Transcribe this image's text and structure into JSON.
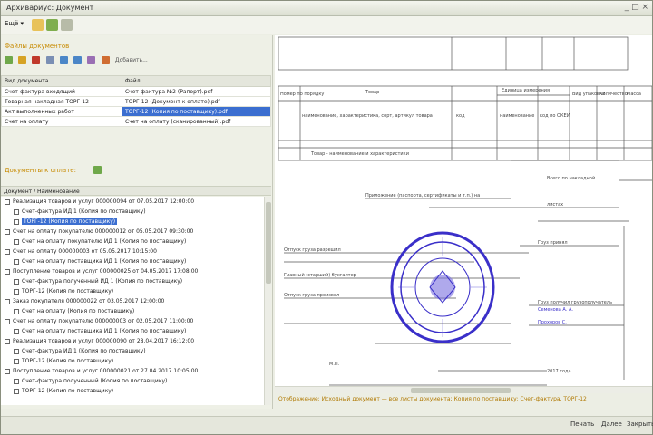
{
  "window": {
    "title": "Архивариус: Документ",
    "controls": "_ □ ×"
  },
  "menubar": {
    "more_label": "Ещё ▾"
  },
  "left": {
    "docs_section_title": "Файлы документов",
    "mini_toolbar_label": "Добавить...",
    "table": {
      "columns": [
        "Вид документа",
        "Файл"
      ],
      "rows": [
        [
          "Счет-фактура входящий",
          "Счет-фактура №2 (Рапорт).pdf"
        ],
        [
          "Товарная накладная ТОРГ-12",
          "ТОРГ-12 (Документ к оплате).pdf"
        ],
        [
          "Акт выполненных работ",
          "ТОРГ-12 (Копия по поставщику).pdf"
        ],
        [
          "Счет на оплату",
          "Счет на оплату (сканированный).pdf"
        ]
      ]
    },
    "links_section_title": "Документы к оплате:",
    "tree": {
      "header": "Документ / Наименование",
      "items": [
        {
          "level": 0,
          "label": "Реализация товаров и услуг 000000094 от 07.05.2017 12:00:00"
        },
        {
          "level": 1,
          "label": "Счет-фактура ИД 1 (Копия по поставщику)"
        },
        {
          "level": 1,
          "label": "ТОРГ-12 (Копия по поставщику)",
          "selected": true
        },
        {
          "level": 0,
          "label": "Счет на оплату покупателю 000000012 от 05.05.2017 09:30:00"
        },
        {
          "level": 1,
          "label": "Счет на оплату покупателю ИД 1 (Копия по поставщику)"
        },
        {
          "level": 0,
          "label": "Счет на оплату 000000003 от 05.05.2017 10:15:00"
        },
        {
          "level": 1,
          "label": "Счет на оплату поставщика ИД 1 (Копия по поставщику)"
        },
        {
          "level": 0,
          "label": "Поступление товаров и услуг 000000025 от 04.05.2017 17:08:00"
        },
        {
          "level": 1,
          "label": "Счет-фактура полученный ИД 1 (Копия по поставщику)"
        },
        {
          "level": 1,
          "label": "ТОРГ-12 (Копия по поставщику)"
        },
        {
          "level": 0,
          "label": "Заказ покупателя 000000022 от 03.05.2017 12:00:00"
        },
        {
          "level": 1,
          "label": "Счет на оплату (Копия по поставщику)"
        },
        {
          "level": 0,
          "label": "Счет на оплату покупателю 000000003 от 02.05.2017 11:00:00"
        },
        {
          "level": 1,
          "label": "Счет на оплату поставщика ИД 1 (Копия по поставщику)"
        },
        {
          "level": 0,
          "label": "Реализация товаров и услуг 000000090 от 28.04.2017 16:12:00"
        },
        {
          "level": 1,
          "label": "Счет-фактура ИД 1 (Копия по поставщику)"
        },
        {
          "level": 1,
          "label": "ТОРГ-12 (Копия по поставщику)"
        },
        {
          "level": 0,
          "label": "Поступление товаров и услуг 000000021 от 27.04.2017 10:05:00"
        },
        {
          "level": 1,
          "label": "Счет-фактура полученный (Копия по поставщику)"
        },
        {
          "level": 1,
          "label": "ТОРГ-12 (Копия по поставщику)"
        }
      ]
    }
  },
  "doc": {
    "header_cells": [
      "Номер по порядку",
      "Товар",
      "Единица измерения",
      "Вид упаковки",
      "Количество",
      "Масса",
      "Цена"
    ],
    "sub_cells": [
      "наименование, характеристика, сорт, артикул товара",
      "код",
      "наименование",
      "код по ОКЕИ"
    ],
    "row_label": "Товар - наименование и характеристики",
    "signatures": {
      "total": "Всего по накладной",
      "attachment": "Приложение (паспорта, сертификаты и т.п.) на",
      "sheets": "листах",
      "cargo_passed": "Отпуск груза разрешил",
      "head_accountant": "Главный (старший) бухгалтер",
      "released": "Отпуск груза произвел",
      "accepted": "Груз принял",
      "received": "Груз получил грузополучатель",
      "name1": "Семенова А. А.",
      "name2": "Прохоров С.",
      "date_label": "2017 года",
      "mp": "М.П."
    }
  },
  "statusline": "Отображение: Исходный документ — все листы документа; Копия по поставщику: Счет-фактура, ТОРГ-12",
  "bottombar": {
    "btn1": "Печать",
    "btn2": "Далее",
    "btn3": "Закрыть"
  },
  "colors": {
    "accent": "#3b6ed0",
    "section_title": "#c78a00",
    "stamp": "#3a2fc9"
  }
}
